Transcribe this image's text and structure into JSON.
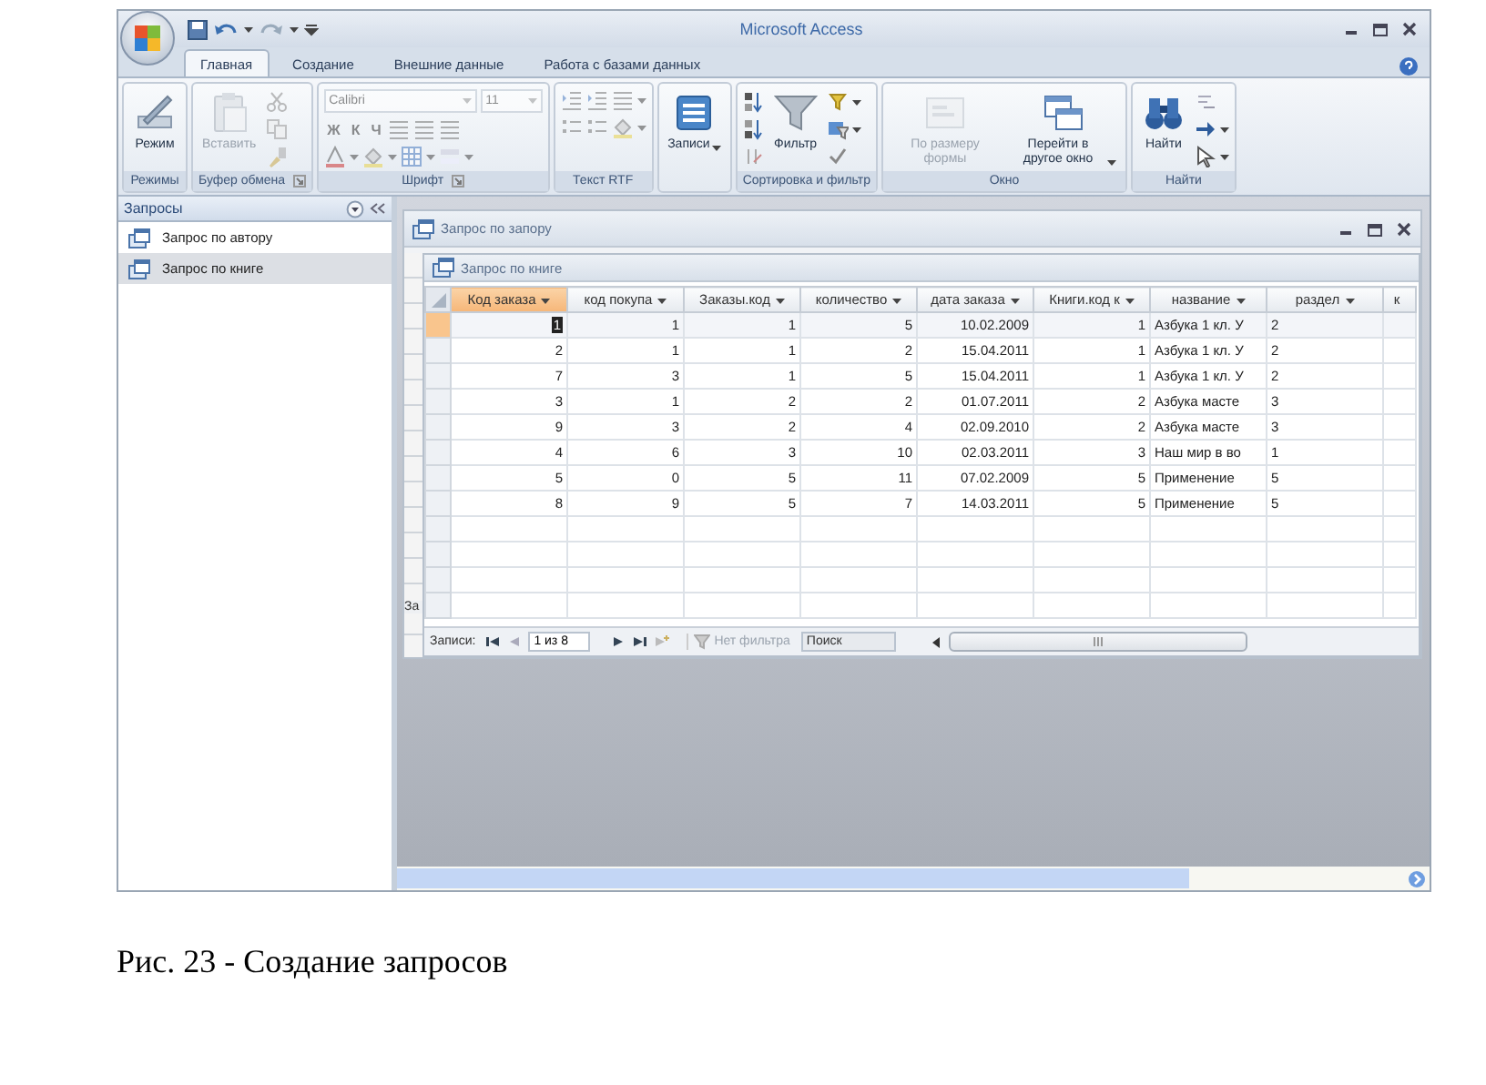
{
  "window": {
    "title": "Microsoft Access"
  },
  "ribbon_tabs": [
    {
      "label": "Главная",
      "selected": true
    },
    {
      "label": "Создание",
      "selected": false
    },
    {
      "label": "Внешние данные",
      "selected": false
    },
    {
      "label": "Работа с базами данных",
      "selected": false
    }
  ],
  "ribbon_groups": [
    {
      "kind": "views",
      "label": "Режимы",
      "controls": [
        {
          "kind": "view",
          "label": "Режим",
          "disabled": false
        }
      ]
    },
    {
      "kind": "clipboard",
      "label": "Буфер обмена",
      "disabled": true,
      "controls": [
        {
          "kind": "paste",
          "label": "Вставить",
          "disabled": true
        }
      ]
    },
    {
      "kind": "font",
      "label": "Шрифт",
      "disabled": true,
      "font_name": "Calibri",
      "font_size": "11",
      "format_buttons": [
        "Ж",
        "К",
        "Ч"
      ]
    },
    {
      "kind": "rtf",
      "label": "Текст RTF",
      "disabled": true
    },
    {
      "kind": "records",
      "controls": [
        {
          "kind": "records",
          "label": "Записи",
          "disabled": false,
          "dropdown": true
        }
      ]
    },
    {
      "kind": "sort",
      "label": "Сортировка и фильтр",
      "disabled": false,
      "controls": [
        {
          "kind": "filter",
          "label": "Фильтр",
          "disabled": false
        }
      ]
    },
    {
      "kind": "window",
      "label": "Окно",
      "controls": [
        {
          "kind": "fit",
          "label": "По размеру формы",
          "disabled": true
        },
        {
          "kind": "switch",
          "label": "Перейти в другое окно",
          "disabled": false,
          "dropdown": true
        }
      ]
    },
    {
      "kind": "find",
      "label": "Найти",
      "disabled": false,
      "controls": [
        {
          "kind": "find",
          "label": "Найти",
          "disabled": false
        }
      ]
    }
  ],
  "nav_pane": {
    "title": "Запросы",
    "items": [
      {
        "label": "Запрос по автору",
        "selected": false
      },
      {
        "label": "Запрос по книге",
        "selected": true
      }
    ]
  },
  "back_window": {
    "title": "Запрос по запору",
    "nav_fragment": "За"
  },
  "front_window": {
    "title": "Запрос по книге",
    "columns": [
      {
        "label": "Код заказа",
        "kind": "number",
        "selected": true
      },
      {
        "label": "код покупа",
        "kind": "number",
        "selected": false
      },
      {
        "label": "Заказы.код",
        "kind": "number",
        "selected": false
      },
      {
        "label": "количество",
        "kind": "number",
        "selected": false
      },
      {
        "label": "дата заказа",
        "kind": "date",
        "selected": false
      },
      {
        "label": "Книги.код к",
        "kind": "number",
        "selected": false
      },
      {
        "label": "название",
        "kind": "text",
        "selected": false
      },
      {
        "label": "раздел",
        "kind": "text",
        "selected": false
      },
      {
        "label": "к",
        "kind": "text",
        "selected": false
      }
    ],
    "rows": [
      {
        "selected": true,
        "cells": [
          "1",
          "1",
          "1",
          "5",
          "10.02.2009",
          "1",
          "Азбука 1 кл. У",
          "2"
        ]
      },
      {
        "selected": false,
        "cells": [
          "2",
          "1",
          "1",
          "2",
          "15.04.2011",
          "1",
          "Азбука 1 кл. У",
          "2"
        ]
      },
      {
        "selected": false,
        "cells": [
          "7",
          "3",
          "1",
          "5",
          "15.04.2011",
          "1",
          "Азбука 1 кл. У",
          "2"
        ]
      },
      {
        "selected": false,
        "cells": [
          "3",
          "1",
          "2",
          "2",
          "01.07.2011",
          "2",
          "Азбука масте",
          "3"
        ]
      },
      {
        "selected": false,
        "cells": [
          "9",
          "3",
          "2",
          "4",
          "02.09.2010",
          "2",
          "Азбука масте",
          "3"
        ]
      },
      {
        "selected": false,
        "cells": [
          "4",
          "6",
          "3",
          "10",
          "02.03.2011",
          "3",
          "Наш мир в во",
          "1"
        ]
      },
      {
        "selected": false,
        "cells": [
          "5",
          "0",
          "5",
          "11",
          "07.02.2009",
          "5",
          "Применение",
          "5"
        ]
      },
      {
        "selected": false,
        "cells": [
          "8",
          "9",
          "5",
          "7",
          "14.03.2011",
          "5",
          "Применение",
          "5"
        ]
      }
    ],
    "record_nav": {
      "label": "Записи:",
      "position": "1 из 8",
      "filter": "Нет фильтра",
      "search_placeholder": "Поиск"
    }
  },
  "caption": "Рис. 23 - Создание запросов"
}
